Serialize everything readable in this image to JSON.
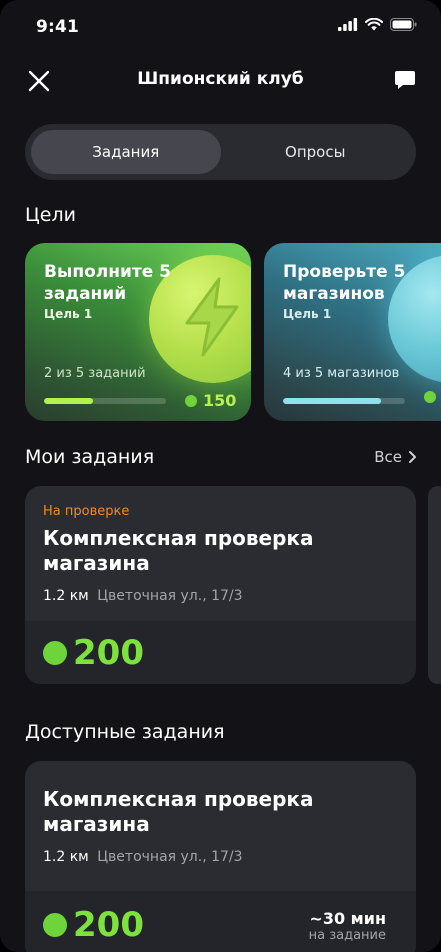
{
  "status_bar": {
    "time": "9:41"
  },
  "header": {
    "title": "Шпионский клуб"
  },
  "segments": [
    {
      "label": "Задания",
      "active": true
    },
    {
      "label": "Опросы",
      "active": false
    }
  ],
  "goals_section": {
    "title": "Цели",
    "items": [
      {
        "title": "Выполните 5 заданий",
        "subtitle": "Цель 1",
        "progress_text": "2 из 5 заданий",
        "progress": 0.4,
        "reward": "150"
      },
      {
        "title": "Проверьте 5 магазинов",
        "subtitle": "Цель 1",
        "progress_text": "4 из 5 магазинов",
        "progress": 0.8,
        "reward": ""
      }
    ]
  },
  "my_tasks": {
    "title": "Мои задания",
    "see_all": "Все",
    "items": [
      {
        "status": "На проверке",
        "title": "Комплексная проверка магазина",
        "distance": "1.2 км",
        "address": "Цветочная ул., 17/3",
        "points": "200"
      }
    ]
  },
  "available_tasks": {
    "title": "Доступные задания",
    "items": [
      {
        "title": "Комплексная проверка магазина",
        "distance": "1.2 км",
        "address": "Цветочная ул., 17/3",
        "points": "200",
        "time": "~30 мин",
        "time_caption": "на задание"
      }
    ]
  }
}
